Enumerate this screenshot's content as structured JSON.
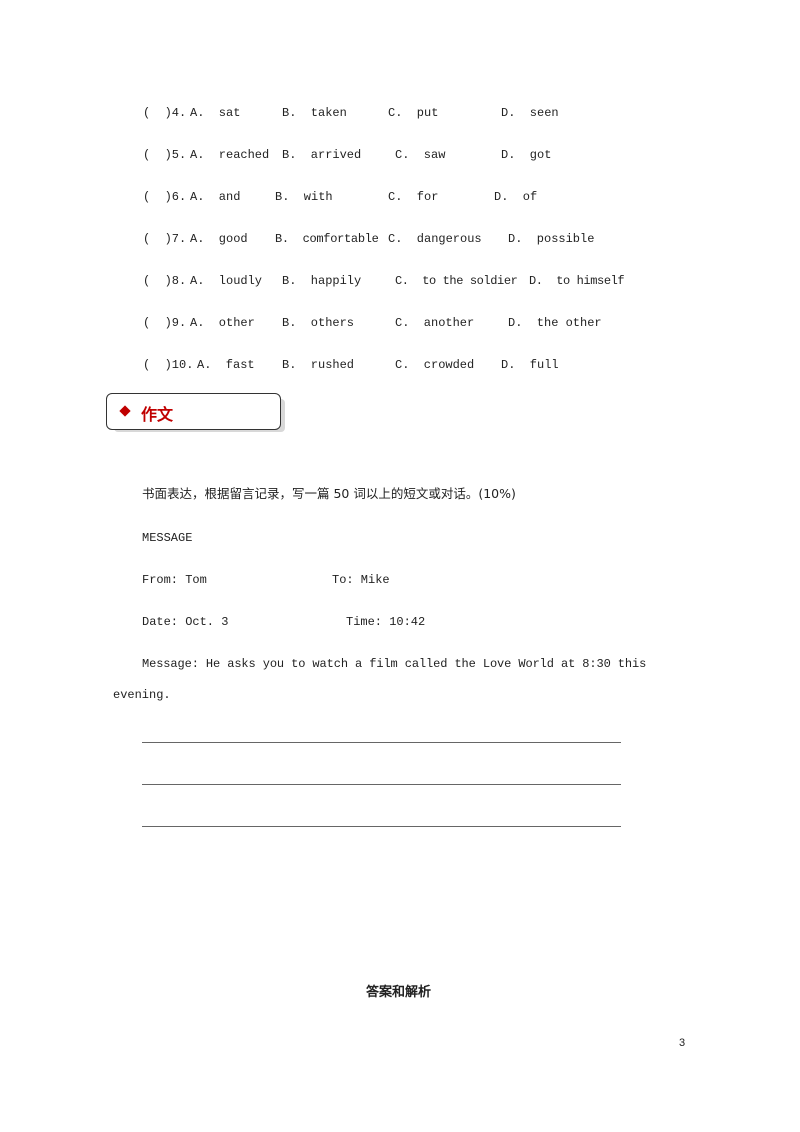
{
  "questions": [
    {
      "prefix": "(  )4.",
      "a": "A.  sat",
      "b": "B.  taken",
      "c": "C.  put",
      "d": "D.  seen"
    },
    {
      "prefix": "(  )5.",
      "a": "A.  reached",
      "b": "B.  arrived",
      "c": "C.  saw",
      "d": "D.  got"
    },
    {
      "prefix": "(  )6.",
      "a": "A.  and",
      "b": "B.  with",
      "c": "C.  for",
      "d": "D.  of"
    },
    {
      "prefix": "(  )7.",
      "a": "A.  good",
      "b": "B.  comfortable",
      "c": "C.  dangerous",
      "d": "D.  possible"
    },
    {
      "prefix": "(  )8.",
      "a": "A.  loudly",
      "b": "B.  happily",
      "c": "C.  to the soldier",
      "d": "D.  to himself"
    },
    {
      "prefix": "(  )9.",
      "a": "A.  other",
      "b": "B.  others",
      "c": "C.  another",
      "d": "D.  the other"
    },
    {
      "prefix": "(  )10.",
      "a": "A.  fast",
      "b": "B.  rushed",
      "c": "C.  crowded",
      "d": "D.  full"
    }
  ],
  "section": {
    "title": "作文",
    "accent_color": "#c00000"
  },
  "writing": {
    "instruction": "书面表达，根据留言记录，写一篇 50 词以上的短文或对话。(10%)",
    "message_heading": "MESSAGE",
    "from": "From: Tom",
    "to": "To: Mike",
    "date": "Date: Oct. 3",
    "time": "Time: 10:42",
    "message_line1": "Message: He asks you to watch a film called the Love World at 8:30 this",
    "message_line2": "evening."
  },
  "answers_heading": "答案和解析",
  "page_number": "3"
}
